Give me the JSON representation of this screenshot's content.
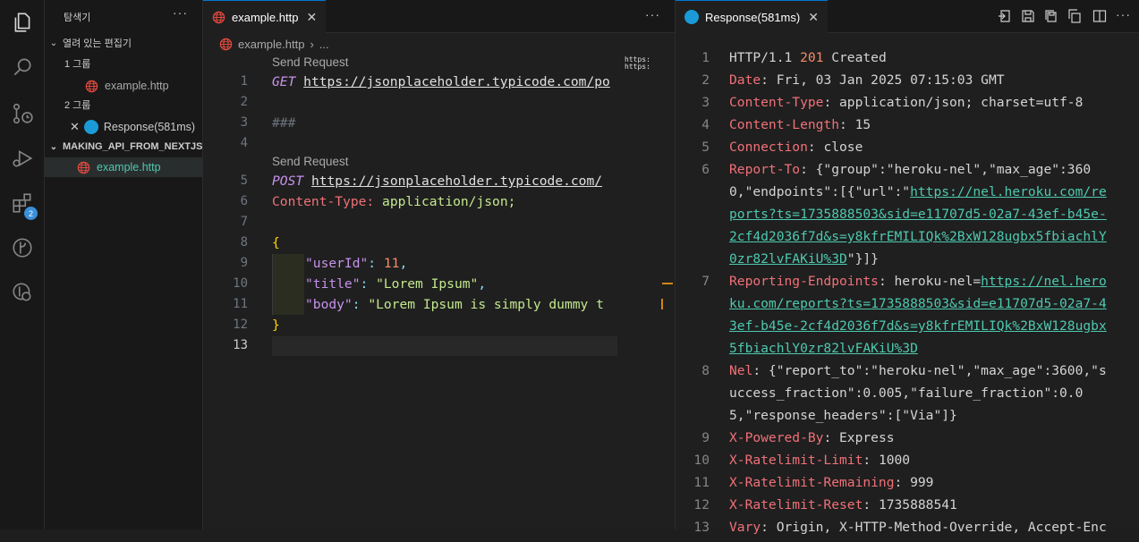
{
  "activity": {
    "badge": "2"
  },
  "sidebar": {
    "title": "탐색기",
    "more": "···",
    "open_editors": "열려 있는 편집기",
    "group1": "1 그룹",
    "group1_file": "example.http",
    "group2": "2 그룹",
    "group2_file": "Response(581ms)",
    "folder": "MAKING_API_FROM_NEXTJS",
    "folder_file": "example.http"
  },
  "editor": {
    "tab": "example.http",
    "tab_close": "✕",
    "more": "···",
    "crumb_file": "example.http",
    "crumb_more": "...",
    "lens1": "Send Request",
    "lens2": "Send Request",
    "line_numbers": [
      "1",
      "2",
      "3",
      "4",
      "5",
      "6",
      "7",
      "8",
      "9",
      "10",
      "11",
      "12",
      "13"
    ],
    "l1_method": "GET",
    "l1_url": "https://jsonplaceholder.typicode.com/po",
    "l3": "###",
    "l5_method": "POST",
    "l5_url": "https://jsonplaceholder.typicode.com/",
    "l6_key": "Content-Type:",
    "l6_val": "application/json;",
    "l8": "{",
    "l9_key": "\"userId\"",
    "l9_colon": ":",
    "l9_val": "11",
    "l9_comma": ",",
    "l10_key": "\"title\"",
    "l10_colon": ":",
    "l10_val": "\"Lorem Ipsum\"",
    "l10_comma": ",",
    "l11_key": "\"body\"",
    "l11_colon": ":",
    "l11_val": "\"Lorem Ipsum is simply dummy t",
    "l12": "}",
    "minimap_text1": "https:",
    "minimap_text2": "https:"
  },
  "response": {
    "tab": "Response(581ms)",
    "tab_close": "✕",
    "lines": [
      {
        "n": "1",
        "k": "HTTP/1.1 ",
        "v": "201",
        "r": " Created"
      },
      {
        "n": "2",
        "k": "Date",
        "v": ": Fri, 03 Jan 2025 07:15:03 GMT"
      },
      {
        "n": "3",
        "k": "Content-Type",
        "v": ": application/json; charset=utf-8"
      },
      {
        "n": "4",
        "k": "Content-Length",
        "v": ": 15"
      },
      {
        "n": "5",
        "k": "Connection",
        "v": ": close"
      },
      {
        "n": "6",
        "k": "Report-To",
        "v": ": {\"group\":\"heroku-nel\",\"max_age\":360"
      },
      {
        "n": "",
        "k": "",
        "v": "0,\"endpoints\":[{\"url\":\"",
        "u": "https://nel.heroku.com/re"
      },
      {
        "n": "",
        "k": "",
        "v": "",
        "u": "ports?ts=1735888503&sid=e11707d5-02a7-43ef-b45e-"
      },
      {
        "n": "",
        "k": "",
        "v": "",
        "u": "2cf4d2036f7d&s=y8kfrEMILIQk%2BxW128ugbx5fbiachlY"
      },
      {
        "n": "",
        "k": "",
        "v": "",
        "u": "0zr82lvFAKiU%3D",
        "r": "\"}]}"
      },
      {
        "n": "7",
        "k": "Reporting-Endpoints",
        "v": ": heroku-nel=",
        "u": "https://nel.hero"
      },
      {
        "n": "",
        "k": "",
        "v": "",
        "u": "ku.com/reports?ts=1735888503&sid=e11707d5-02a7-4"
      },
      {
        "n": "",
        "k": "",
        "v": "",
        "u": "3ef-b45e-2cf4d2036f7d&s=y8kfrEMILIQk%2BxW128ugbx"
      },
      {
        "n": "",
        "k": "",
        "v": "",
        "u": "5fbiachlY0zr82lvFAKiU%3D"
      },
      {
        "n": "8",
        "k": "Nel",
        "v": ": {\"report_to\":\"heroku-nel\",\"max_age\":3600,\"s"
      },
      {
        "n": "",
        "k": "",
        "v": "uccess_fraction\":0.005,\"failure_fraction\":0.0"
      },
      {
        "n": "",
        "k": "",
        "v": "5,\"response_headers\":[\"Via\"]}"
      },
      {
        "n": "9",
        "k": "X-Powered-By",
        "v": ": Express"
      },
      {
        "n": "10",
        "k": "X-Ratelimit-Limit",
        "v": ": 1000"
      },
      {
        "n": "11",
        "k": "X-Ratelimit-Remaining",
        "v": ": 999"
      },
      {
        "n": "12",
        "k": "X-Ratelimit-Reset",
        "v": ": 1735888541"
      },
      {
        "n": "13",
        "k": "Vary",
        "v": ": Origin, X-HTTP-Method-Override, Accept-Enc"
      }
    ]
  }
}
